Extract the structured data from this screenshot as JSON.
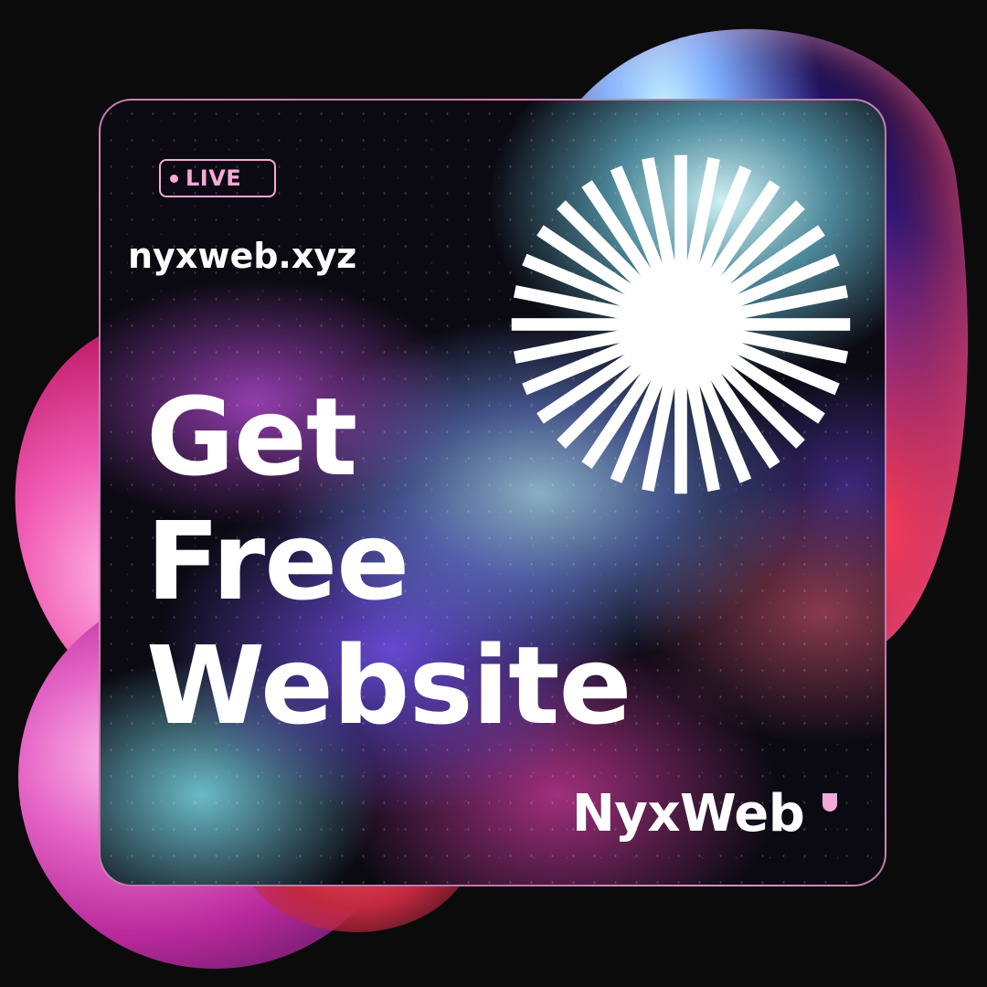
{
  "badge": {
    "label": "LIVE"
  },
  "site": {
    "domain": "nyxweb.xyz"
  },
  "headline": {
    "line1": "Get",
    "line2": "Free",
    "line3": "Website"
  },
  "brand": {
    "name": "NyxWeb"
  },
  "colors": {
    "accent_pink": "#f6a8d8",
    "text": "#ffffff",
    "background": "#0b0b0c"
  },
  "icons": {
    "badge_dot": "live-dot-icon",
    "graphic": "sunburst-icon",
    "brand_mark": "brand-mark-icon"
  }
}
